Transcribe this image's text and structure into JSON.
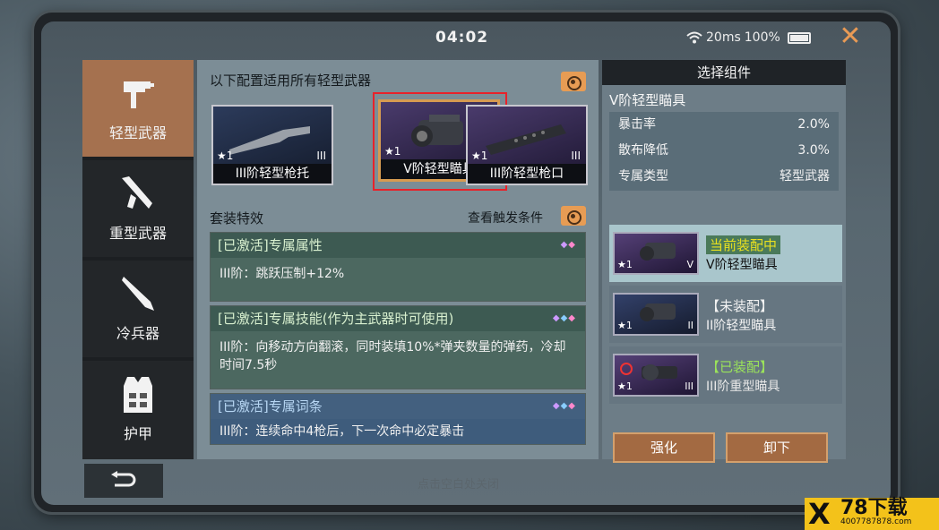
{
  "status": {
    "time": "04:02",
    "ping": "20ms",
    "battery": "100%"
  },
  "sidebar": {
    "items": [
      {
        "label": "轻型武器"
      },
      {
        "label": "重型武器"
      },
      {
        "label": "冷兵器"
      },
      {
        "label": "护甲"
      }
    ]
  },
  "main": {
    "title": "以下配置适用所有轻型武器",
    "cards": [
      {
        "name": "III阶轻型枪托",
        "level": "★1",
        "tier": "III"
      },
      {
        "name": "V阶轻型瞄具",
        "level": "★1",
        "tier": "V"
      },
      {
        "name": "III阶轻型枪口",
        "level": "★1",
        "tier": "III"
      }
    ],
    "set_title": "套装特效",
    "view_conditions": "查看触发条件",
    "effects": [
      {
        "header": "[已激活]专属属性",
        "body": "III阶：跳跃压制+12%"
      },
      {
        "header": "[已激活]专属技能(作为主武器时可使用)",
        "body": "III阶：向移动方向翻滚，同时装填10%*弹夹数量的弹药，冷却时间7.5秒"
      },
      {
        "header": "[已激活]专属词条",
        "body": "III阶：连续命中4枪后，下一次命中必定暴击"
      }
    ]
  },
  "right": {
    "title": "选择组件",
    "selected_name": "V阶轻型瞄具",
    "stats": [
      {
        "label": "暴击率",
        "value": "2.0%"
      },
      {
        "label": "散布降低",
        "value": "3.0%"
      },
      {
        "label": "专属类型",
        "value": "轻型武器"
      }
    ],
    "slots": [
      {
        "status": "当前装配中",
        "name": "V阶轻型瞄具",
        "level": "★1",
        "tier": "V"
      },
      {
        "status": "【未装配】",
        "name": "II阶轻型瞄具",
        "level": "★1",
        "tier": "II"
      },
      {
        "status": "【已装配】",
        "name": "III阶重型瞄具",
        "level": "★1",
        "tier": "III"
      }
    ],
    "btn_upgrade": "强化",
    "btn_remove": "卸下"
  },
  "footer": {
    "hint": "点击空白处关闭"
  },
  "watermark": {
    "mark": "X",
    "name": "78下载",
    "url": "4007787878.com"
  },
  "colors": {
    "accent": "#a5714f",
    "orange": "#e79c54",
    "highlight_red": "#e8222a"
  }
}
